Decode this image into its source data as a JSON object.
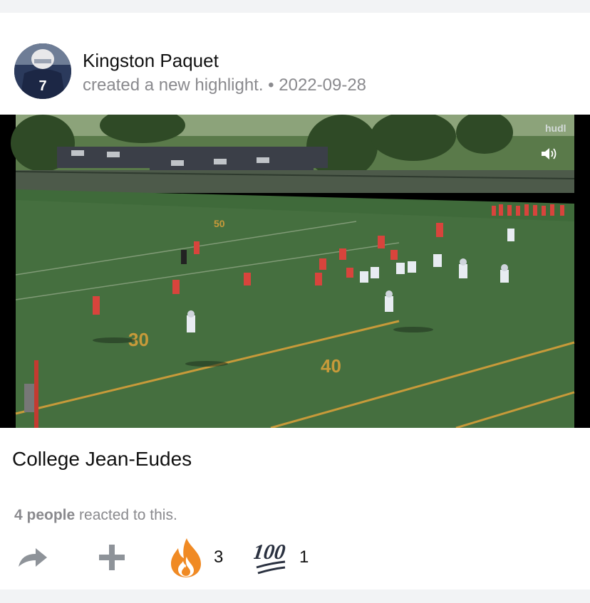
{
  "post": {
    "author": "Kingston Paquet",
    "action_text": "created a new highlight.",
    "separator": "•",
    "date": "2022-09-28",
    "avatar_jersey": "7",
    "caption": "College Jean-Eudes"
  },
  "video": {
    "watermark": "hudl",
    "field_numbers": [
      "30",
      "40",
      "50"
    ],
    "volume_icon": "speaker-icon"
  },
  "reactions": {
    "people_count": "4 people",
    "suffix": "reacted to this.",
    "items": [
      {
        "icon": "fire-icon",
        "count": "3"
      },
      {
        "icon": "hundred-points-icon",
        "count": "1",
        "glyph": "100"
      }
    ]
  },
  "icons": {
    "share": "share-arrow-icon",
    "add": "plus-icon"
  },
  "colors": {
    "muted_text": "#8a8a8e",
    "icon_gray": "#8e9399",
    "field_green": "#3f6a3a",
    "home_red": "#d8443c",
    "fire_orange": "#f08a24"
  }
}
